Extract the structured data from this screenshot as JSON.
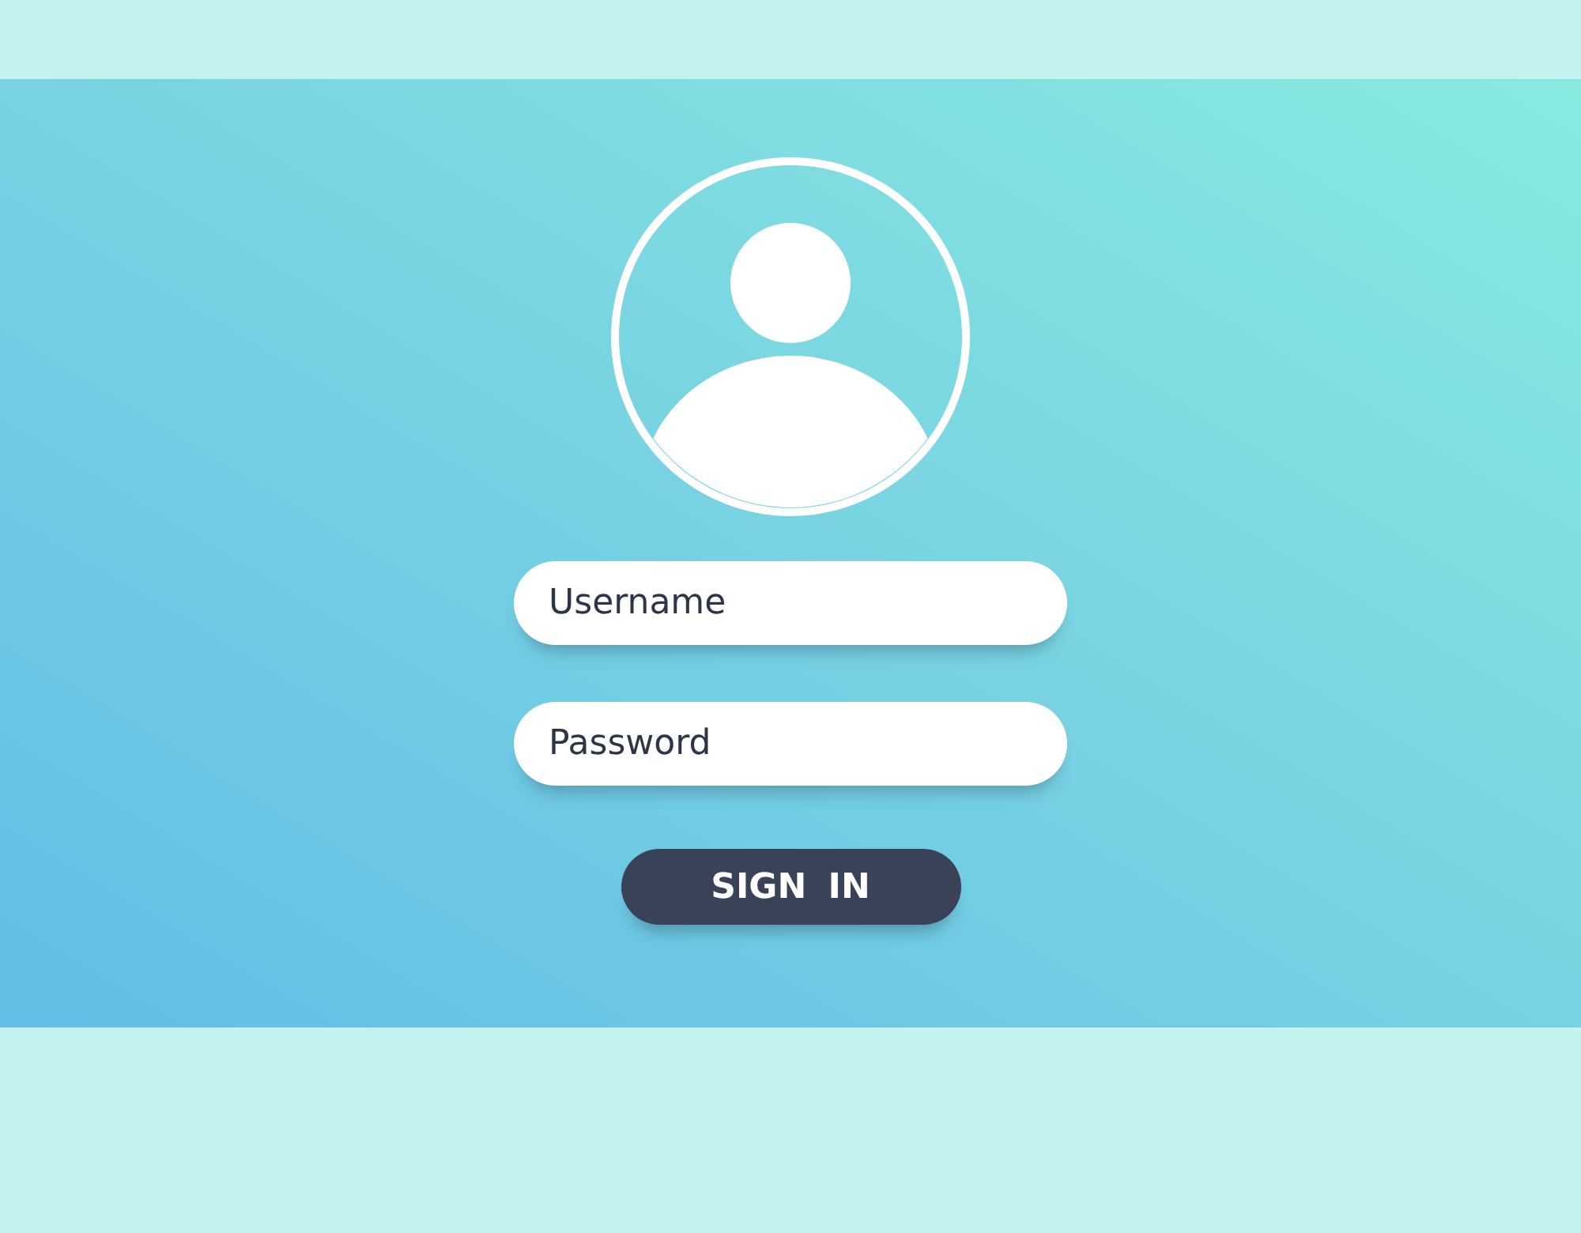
{
  "fields": [
    {
      "placeholder": "Username"
    },
    {
      "placeholder": "Password"
    }
  ],
  "button": {
    "label": "SIGN IN"
  }
}
